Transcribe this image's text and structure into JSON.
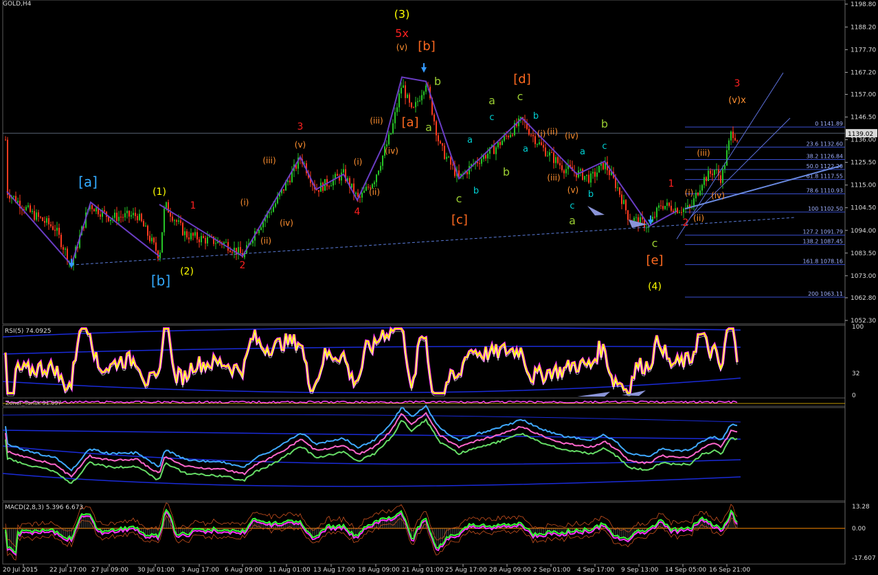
{
  "symbol": "GOLD,H4",
  "price_axis": {
    "ticks": [
      "1198.80",
      "1188.20",
      "1177.70",
      "1167.20",
      "1157.00",
      "1146.50",
      "1136.00",
      "1125.50",
      "1115.00",
      "1104.50",
      "1094.00",
      "1083.50",
      "1073.00",
      "1062.80",
      "1052.30"
    ],
    "current": "1139.02"
  },
  "time_axis": [
    "20 Jul 2015",
    "22 Jul 17:00",
    "27 Jul 09:00",
    "30 Jul 01:00",
    "3 Aug 17:00",
    "6 Aug 09:00",
    "11 Aug 01:00",
    "13 Aug 17:00",
    "18 Aug 09:00",
    "21 Aug 01:00",
    "25 Aug 17:00",
    "28 Aug 09:00",
    "2 Sep 01:00",
    "4 Sep 17:00",
    "9 Sep 13:00",
    "14 Sep 05:00",
    "16 Sep 21:00"
  ],
  "fib_levels": [
    {
      "label": "0 1141.89",
      "price": 1141.89
    },
    {
      "label": "23.6 1132.60",
      "price": 1132.6
    },
    {
      "label": "38.2 1126.84",
      "price": 1126.84
    },
    {
      "label": "50.0 1122.20",
      "price": 1122.2
    },
    {
      "label": "61.8 1117.55",
      "price": 1117.55
    },
    {
      "label": "78.6 1110.93",
      "price": 1110.93
    },
    {
      "label": "100 1102.50",
      "price": 1102.5
    },
    {
      "label": "127.2 1091.79",
      "price": 1091.79
    },
    {
      "label": "138.2 1087.45",
      "price": 1087.45
    },
    {
      "label": "161.8 1078.16",
      "price": 1078.16
    },
    {
      "label": "200 1063.11",
      "price": 1063.11
    }
  ],
  "wave_labels": [
    {
      "t": "(3)",
      "c": "#ffff00",
      "x": 585,
      "y": 26,
      "s": 16
    },
    {
      "t": "5x",
      "c": "#ff2020",
      "x": 585,
      "y": 54,
      "s": 16
    },
    {
      "t": "[b]",
      "c": "#ff6a20",
      "x": 621,
      "y": 73,
      "s": 18
    },
    {
      "t": "(v)",
      "c": "#ff9030",
      "x": 585,
      "y": 73,
      "s": 12
    },
    {
      "t": "[a]",
      "c": "#33aaff",
      "x": 128,
      "y": 272,
      "s": 20
    },
    {
      "t": "(1)",
      "c": "#ffff00",
      "x": 232,
      "y": 284,
      "s": 14
    },
    {
      "t": "1",
      "c": "#ff2020",
      "x": 281,
      "y": 304,
      "s": 14
    },
    {
      "t": "[b]",
      "c": "#33aaff",
      "x": 234,
      "y": 416,
      "s": 20
    },
    {
      "t": "(2)",
      "c": "#ffff00",
      "x": 272,
      "y": 400,
      "s": 14
    },
    {
      "t": "2",
      "c": "#ff2020",
      "x": 353,
      "y": 391,
      "s": 14
    },
    {
      "t": "3",
      "c": "#ff2020",
      "x": 437,
      "y": 189,
      "s": 14
    },
    {
      "t": "(v)",
      "c": "#ff9030",
      "x": 437,
      "y": 215,
      "s": 12
    },
    {
      "t": "(iii)",
      "c": "#ff9030",
      "x": 392,
      "y": 238,
      "s": 12
    },
    {
      "t": "(i)",
      "c": "#ff9030",
      "x": 356,
      "y": 299,
      "s": 12
    },
    {
      "t": "(iv)",
      "c": "#ff9030",
      "x": 417,
      "y": 329,
      "s": 12
    },
    {
      "t": "(ii)",
      "c": "#ff9030",
      "x": 387,
      "y": 355,
      "s": 12
    },
    {
      "t": "4",
      "c": "#ff2020",
      "x": 520,
      "y": 313,
      "s": 14
    },
    {
      "t": "(i)",
      "c": "#ff9030",
      "x": 521,
      "y": 240,
      "s": 12
    },
    {
      "t": "(ii)",
      "c": "#ff9030",
      "x": 545,
      "y": 284,
      "s": 12
    },
    {
      "t": "(iii)",
      "c": "#ff9030",
      "x": 548,
      "y": 180,
      "s": 12
    },
    {
      "t": "(iv)",
      "c": "#ff9030",
      "x": 570,
      "y": 224,
      "s": 12
    },
    {
      "t": "[a]",
      "c": "#ff6a20",
      "x": 597,
      "y": 184,
      "s": 18
    },
    {
      "t": "b",
      "c": "#9acd32",
      "x": 637,
      "y": 124,
      "s": 16
    },
    {
      "t": "a",
      "c": "#9acd32",
      "x": 624,
      "y": 191,
      "s": 16
    },
    {
      "t": "c",
      "c": "#9acd32",
      "x": 668,
      "y": 295,
      "s": 16
    },
    {
      "t": "[c]",
      "c": "#ff6a20",
      "x": 669,
      "y": 326,
      "s": 18
    },
    {
      "t": "a",
      "c": "#00ced1",
      "x": 684,
      "y": 208,
      "s": 13
    },
    {
      "t": "b",
      "c": "#00ced1",
      "x": 693,
      "y": 282,
      "s": 13
    },
    {
      "t": "c",
      "c": "#00ced1",
      "x": 716,
      "y": 175,
      "s": 13
    },
    {
      "t": "a",
      "c": "#9acd32",
      "x": 716,
      "y": 152,
      "s": 16
    },
    {
      "t": "b",
      "c": "#9acd32",
      "x": 737,
      "y": 256,
      "s": 16
    },
    {
      "t": "[d]",
      "c": "#ff6a20",
      "x": 760,
      "y": 121,
      "s": 18
    },
    {
      "t": "c",
      "c": "#9acd32",
      "x": 757,
      "y": 146,
      "s": 16
    },
    {
      "t": "b",
      "c": "#00ced1",
      "x": 780,
      "y": 173,
      "s": 13
    },
    {
      "t": "a",
      "c": "#00ced1",
      "x": 765,
      "y": 221,
      "s": 13
    },
    {
      "t": "(ii)",
      "c": "#ff9030",
      "x": 804,
      "y": 196,
      "s": 12
    },
    {
      "t": "(i)",
      "c": "#ff9030",
      "x": 788,
      "y": 199,
      "s": 12
    },
    {
      "t": "(iv)",
      "c": "#ff9030",
      "x": 832,
      "y": 202,
      "s": 12
    },
    {
      "t": "(iii)",
      "c": "#ff9030",
      "x": 806,
      "y": 263,
      "s": 12
    },
    {
      "t": "(v)",
      "c": "#ff9030",
      "x": 834,
      "y": 281,
      "s": 12
    },
    {
      "t": "a",
      "c": "#00ced1",
      "x": 848,
      "y": 225,
      "s": 13
    },
    {
      "t": "b",
      "c": "#00ced1",
      "x": 860,
      "y": 287,
      "s": 13
    },
    {
      "t": "c",
      "c": "#00ced1",
      "x": 833,
      "y": 304,
      "s": 13
    },
    {
      "t": "a",
      "c": "#9acd32",
      "x": 833,
      "y": 327,
      "s": 16
    },
    {
      "t": "b",
      "c": "#9acd32",
      "x": 880,
      "y": 186,
      "s": 16
    },
    {
      "t": "c",
      "c": "#00ced1",
      "x": 880,
      "y": 217,
      "s": 13
    },
    {
      "t": "c",
      "c": "#9acd32",
      "x": 953,
      "y": 360,
      "s": 16
    },
    {
      "t": "[e]",
      "c": "#ff6a20",
      "x": 953,
      "y": 385,
      "s": 18
    },
    {
      "t": "(4)",
      "c": "#ffff00",
      "x": 953,
      "y": 422,
      "s": 14
    },
    {
      "t": "1",
      "c": "#ff2020",
      "x": 977,
      "y": 272,
      "s": 14
    },
    {
      "t": "2",
      "c": "#ff2020",
      "x": 998,
      "y": 329,
      "s": 14
    },
    {
      "t": "(i)",
      "c": "#ff9030",
      "x": 1003,
      "y": 285,
      "s": 12
    },
    {
      "t": "(ii)",
      "c": "#ff9030",
      "x": 1017,
      "y": 322,
      "s": 12
    },
    {
      "t": "(iii)",
      "c": "#ff9030",
      "x": 1024,
      "y": 227,
      "s": 12
    },
    {
      "t": "(iv)",
      "c": "#ff9030",
      "x": 1045,
      "y": 289,
      "s": 12
    },
    {
      "t": "3",
      "c": "#ff2020",
      "x": 1073,
      "y": 126,
      "s": 14
    },
    {
      "t": "(v)x",
      "c": "#ff9030",
      "x": 1073,
      "y": 150,
      "s": 13
    }
  ],
  "indicators": {
    "rsi": {
      "label": "RSI(5) 74.0925",
      "levels": [
        "100",
        "32",
        "0"
      ]
    },
    "ind2": {
      "label": "Zoner_Yurisk 91.097"
    },
    "macd": {
      "label": "MACD(2,8,3) 5.396 6.673",
      "levels": [
        "13.28",
        "0.00",
        "-17.607"
      ]
    }
  },
  "chart_data": {
    "type": "line",
    "title": "GOLD,H4",
    "x": [
      "20 Jul 2015",
      "22 Jul 17:00",
      "27 Jul 09:00",
      "30 Jul 01:00",
      "3 Aug 17:00",
      "6 Aug 09:00",
      "11 Aug 01:00",
      "13 Aug 17:00",
      "18 Aug 09:00",
      "21 Aug 01:00",
      "25 Aug 17:00",
      "28 Aug 09:00",
      "2 Sep 01:00",
      "4 Sep 17:00",
      "9 Sep 13:00",
      "14 Sep 05:00",
      "16 Sep 21:00"
    ],
    "series": [
      {
        "name": "GOLD,H4",
        "values": [
          1107,
          1080,
          1101,
          1085,
          1090,
          1088,
          1106,
          1115,
          1128,
          1165,
          1122,
          1136,
          1128,
          1118,
          1100,
          1106,
          1140
        ]
      }
    ],
    "ylim": [
      1052.3,
      1198.8
    ],
    "levels": {
      "current": 1139.02
    }
  }
}
